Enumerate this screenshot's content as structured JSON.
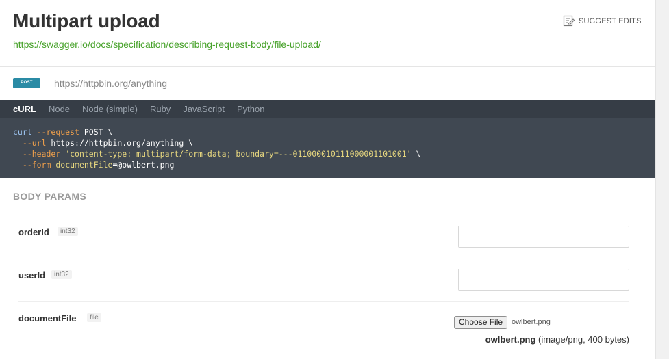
{
  "header": {
    "title": "Multipart upload",
    "link": "https://swagger.io/docs/specification/describing-request-body/file-upload/",
    "suggest_edits": "SUGGEST EDITS"
  },
  "request": {
    "method": "POST",
    "url": "https://httpbin.org/anything"
  },
  "code": {
    "tabs": [
      "cURL",
      "Node",
      "Node (simple)",
      "Ruby",
      "JavaScript",
      "Python"
    ],
    "active_tab": "cURL",
    "lines": {
      "l1_cmd": "curl",
      "l1_flag": "--request",
      "l1_rest": " POST \\",
      "l2_flag": "--url",
      "l2_rest": " https://httpbin.org/anything \\",
      "l3_flag": "--header",
      "l3_str": "'content-type: multipart/form-data; boundary=---011000010111000001101001'",
      "l3_rest": " \\",
      "l4_flag": "--form",
      "l4_str": "documentFile",
      "l4_rest": "=@owlbert.png"
    }
  },
  "body_params": {
    "title": "BODY PARAMS",
    "params": [
      {
        "name": "orderId",
        "type": "int32",
        "value": ""
      },
      {
        "name": "userId",
        "type": "int32",
        "value": ""
      },
      {
        "name": "documentFile",
        "type": "file"
      }
    ],
    "file": {
      "button_label": "Choose File",
      "chosen_name": "owlbert.png",
      "info_name": "owlbert.png",
      "info_meta": "(image/png, 400 bytes)"
    }
  },
  "colors": {
    "link": "#47a22a",
    "method_badge": "#2a8ba5",
    "code_bg": "#404852",
    "code_tabs_bg": "#363d46"
  }
}
